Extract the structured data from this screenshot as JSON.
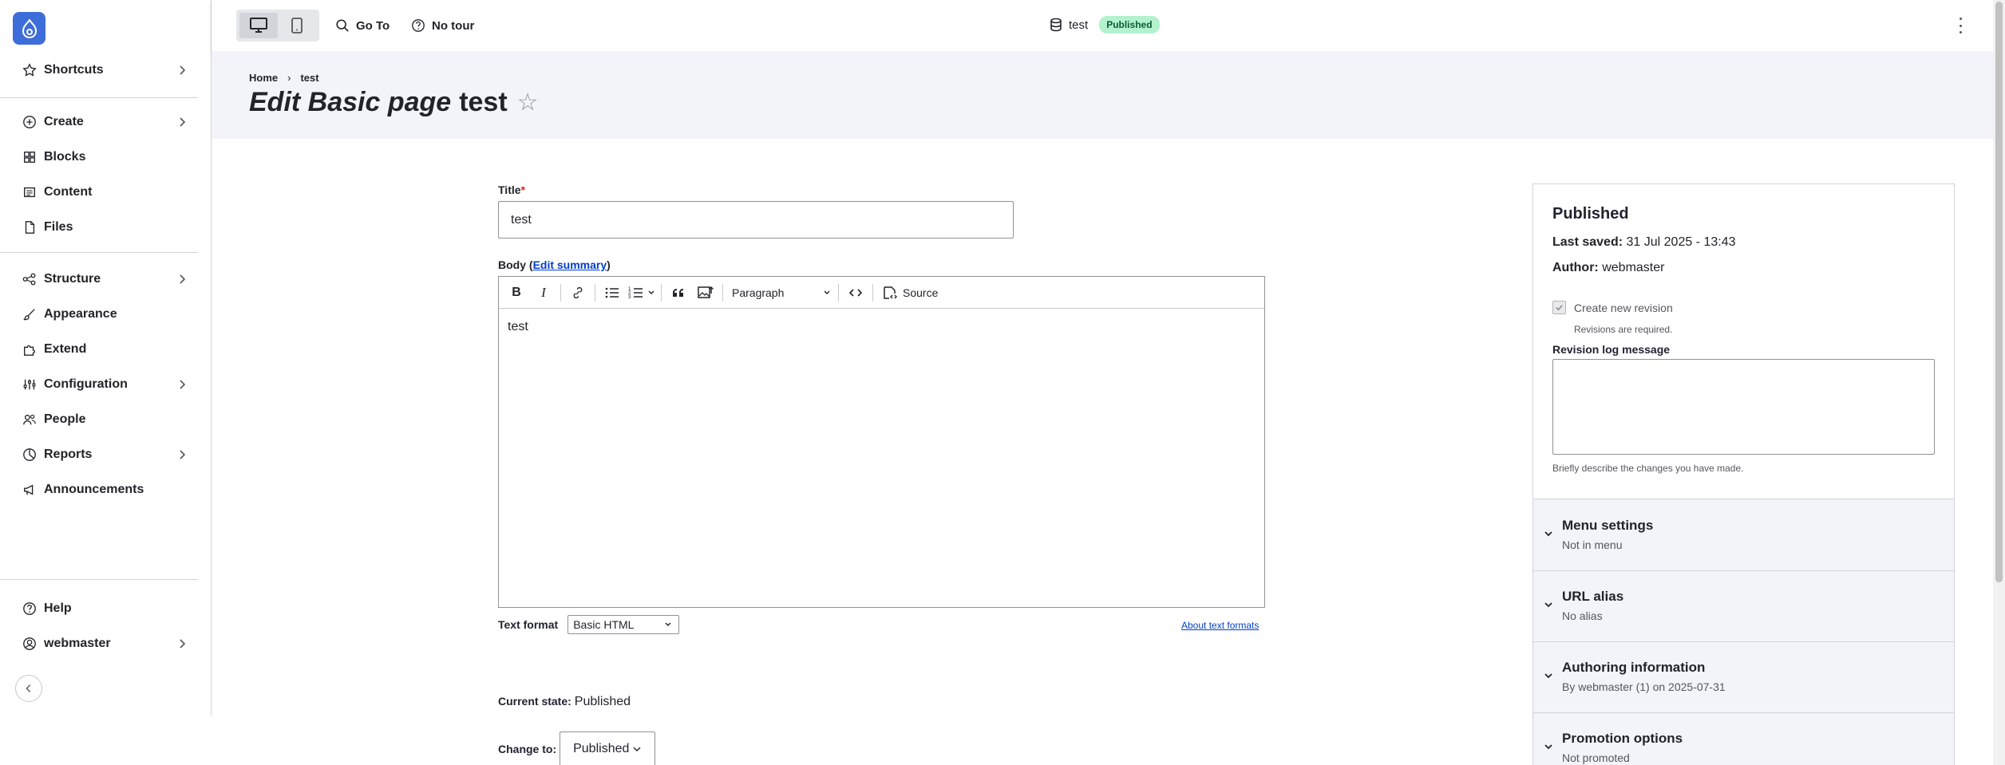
{
  "sidebar": {
    "items": [
      {
        "label": "Shortcuts",
        "icon": "star-icon"
      },
      {
        "label": "Create",
        "icon": "plus-circle-icon"
      },
      {
        "label": "Blocks",
        "icon": "blocks-icon"
      },
      {
        "label": "Content",
        "icon": "content-icon"
      },
      {
        "label": "Files",
        "icon": "file-icon"
      },
      {
        "label": "Structure",
        "icon": "structure-icon"
      },
      {
        "label": "Appearance",
        "icon": "brush-icon"
      },
      {
        "label": "Extend",
        "icon": "puzzle-icon"
      },
      {
        "label": "Configuration",
        "icon": "sliders-icon"
      },
      {
        "label": "People",
        "icon": "people-icon"
      },
      {
        "label": "Reports",
        "icon": "chart-icon"
      },
      {
        "label": "Announcements",
        "icon": "megaphone-icon"
      },
      {
        "label": "Help",
        "icon": "help-icon"
      },
      {
        "label": "webmaster",
        "icon": "user-icon"
      }
    ]
  },
  "toolbar": {
    "goto_label": "Go To",
    "tour_label": "No tour",
    "doc_title": "test",
    "status_badge": "Published"
  },
  "header": {
    "breadcrumb_home": "Home",
    "breadcrumb_current": "test",
    "title_em": "Edit Basic page",
    "title_rest": "test"
  },
  "form": {
    "title_label": "Title",
    "title_value": "test",
    "body_label": "Body",
    "edit_summary": "Edit summary",
    "paragraph_select": "Paragraph",
    "source_label": "Source",
    "body_text": "test",
    "text_format_label": "Text format",
    "text_format_value": "Basic HTML",
    "about_text_formats": "About text formats",
    "current_state_label": "Current state:",
    "current_state_value": "Published",
    "change_to_label": "Change to:",
    "change_to_value": "Published"
  },
  "meta": {
    "status": "Published",
    "last_saved_label": "Last saved:",
    "last_saved_value": "31 Jul 2025 - 13:43",
    "author_label": "Author:",
    "author_value": "webmaster",
    "create_revision": "Create new revision",
    "revisions_required": "Revisions are required.",
    "revision_log_label": "Revision log message",
    "revision_help": "Briefly describe the changes you have made.",
    "sections": [
      {
        "title": "Menu settings",
        "summary": "Not in menu"
      },
      {
        "title": "URL alias",
        "summary": "No alias"
      },
      {
        "title": "Authoring information",
        "summary": "By webmaster (1) on 2025-07-31"
      },
      {
        "title": "Promotion options",
        "summary": "Not promoted"
      }
    ]
  },
  "colors": {
    "brand": "#3d6dd8",
    "badge_bg": "#b2f2cd",
    "link": "#003ecc",
    "header_band": "#f3f4f9"
  }
}
